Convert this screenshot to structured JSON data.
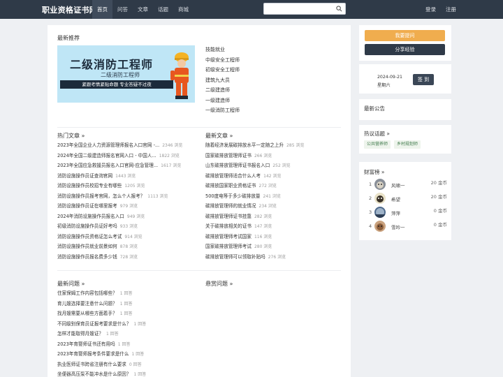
{
  "header": {
    "logo": "职业资格证书网",
    "nav": [
      "首页",
      "问答",
      "文章",
      "话题",
      "商城"
    ],
    "search_placeholder": "",
    "login": "登录",
    "register": "注册"
  },
  "recommend": {
    "title": "最新推荐",
    "banner": {
      "title": "二级消防工程师",
      "subtitle": "二级消防工程师",
      "strip": "紧跟考情紧贴命题 专业答疑不过夜"
    },
    "categories": [
      "技能就业",
      "中级安全工程师",
      "初级安全工程师",
      "建筑九大员",
      "二级建造师",
      "一级建造师",
      "一级消防工程师"
    ]
  },
  "hot_articles": {
    "title": "热门文章 »",
    "items": [
      {
        "t": "2023年全国企业人力资源管理师报名入口官网 -...",
        "v": "2346 浏览"
      },
      {
        "t": "2024年全国二级建造师报名官网入口 - 中国人...",
        "v": "1822 浏览"
      },
      {
        "t": "2023年全国应急救援员报名入口官网-应急管理...",
        "v": "1617 浏览"
      },
      {
        "t": "消防设施操作员证查询官网",
        "v": "1443 浏览"
      },
      {
        "t": "消防设施操作员校招专业有哪些",
        "v": "1205 浏览"
      },
      {
        "t": "消防设施操作员报考官网，怎么个人报考？",
        "v": "1113 浏览"
      },
      {
        "t": "消防设施操作员证在哪里报考",
        "v": "979 浏览"
      },
      {
        "t": "2024年消防设施操作员报名入口",
        "v": "949 浏览"
      },
      {
        "t": "初级消防设施操作员证好考吗",
        "v": "933 浏览"
      },
      {
        "t": "消防设施操作员资格证怎么考试",
        "v": "914 浏览"
      },
      {
        "t": "消防设施操作员就业前景如何",
        "v": "878 浏览"
      },
      {
        "t": "消防设施操作员报名费多少钱",
        "v": "728 浏览"
      }
    ]
  },
  "new_articles": {
    "title": "最新文章 »",
    "items": [
      {
        "t": "随着经济发展碳排放水平一定随之上升",
        "v": "285 浏览"
      },
      {
        "t": "国家碳排放管理师证书",
        "v": "266 浏览"
      },
      {
        "t": "山东碳排放管理师证书报名入口",
        "v": "252 浏览"
      },
      {
        "t": "碳排放管理师适合什么人考",
        "v": "142 浏览"
      },
      {
        "t": "碳排放国家职业资格证书",
        "v": "272 浏览"
      },
      {
        "t": "500度电等于多少碳排放量",
        "v": "241 浏览"
      },
      {
        "t": "碳排放管理师的就业情况",
        "v": "234 浏览"
      },
      {
        "t": "碳排放管理师证书挂靠",
        "v": "282 浏览"
      },
      {
        "t": "关于碳排放相关的证书",
        "v": "147 浏览"
      },
      {
        "t": "碳排放管理师考试国家",
        "v": "116 浏览"
      },
      {
        "t": "国家碳排放管理师考试",
        "v": "280 浏览"
      },
      {
        "t": "碳排放管理师可以领取补贴吗",
        "v": "276 浏览"
      }
    ]
  },
  "new_questions": {
    "title": "最新问题 »",
    "items": [
      {
        "t": "住家保姆工作内容包括哪些？",
        "v": "1 回答"
      },
      {
        "t": "育儿嫂选择要注意什么问题？",
        "v": "1 回答"
      },
      {
        "t": "找月嫂需要从哪些方面着手？",
        "v": "1 回答"
      },
      {
        "t": "不同级别保育员证报考要求是什么？",
        "v": "1 回答"
      },
      {
        "t": "怎样才能取得月嫂证？",
        "v": "1 回答"
      },
      {
        "t": "2023年育婴师证书还有用吗",
        "v": "1 回答"
      },
      {
        "t": "2023年育婴师报考条件要求是什么",
        "v": "1 回答"
      },
      {
        "t": "执业医师证书跨省注册有什么要求",
        "v": "0 回答"
      },
      {
        "t": "坐便器高压泵不能冲水是什么原因？",
        "v": "1 回答"
      }
    ]
  },
  "reward_questions": {
    "title": "悬赏问题 »"
  },
  "sidebar": {
    "ask_button": "我要提问",
    "share_button": "分享经验",
    "date": "2024-09-21",
    "weekday": "星期六",
    "checkin": "签 到",
    "notice_title": "最新公告",
    "topics_title": "热议话题 »",
    "tags": [
      "公共营养师",
      "乡村规划师"
    ],
    "rank_title": "财富榜 »",
    "ranking": [
      {
        "n": "1",
        "name": "风啸一",
        "coin": "20 金币"
      },
      {
        "n": "2",
        "name": "希望",
        "coin": "20 金币"
      },
      {
        "n": "3",
        "name": "萍萍",
        "coin": "0 金币"
      },
      {
        "n": "4",
        "name": "雪吟一",
        "coin": "0 金币"
      }
    ]
  },
  "colors": {
    "header_bg": "#2f3a48",
    "orange": "#f0ad4e",
    "page_bg": "#eef0f3"
  }
}
